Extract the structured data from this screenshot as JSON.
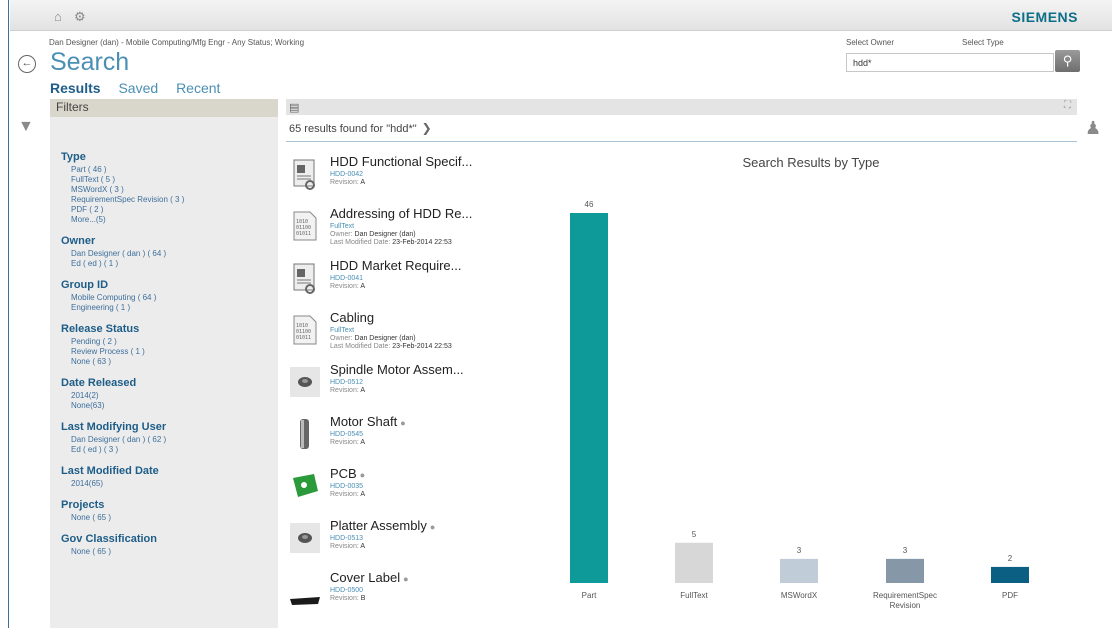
{
  "topbar": {
    "home_icon": "home-icon",
    "settings_icon": "gear-icon",
    "brand": "SIEMENS"
  },
  "context": "Dan Designer (dan) - Mobile Computing/Mfg Engr - Any Status; Working",
  "title": "Search",
  "tabs": [
    {
      "label": "Results",
      "active": true
    },
    {
      "label": "Saved",
      "active": false
    },
    {
      "label": "Recent",
      "active": false
    }
  ],
  "search": {
    "owner_label": "Select Owner",
    "type_label": "Select Type",
    "value": "hdd*"
  },
  "filters": {
    "header": "Filters",
    "groups": [
      {
        "title": "Type",
        "items": [
          "Part ( 46 )",
          "FullText ( 5 )",
          "MSWordX ( 3 )",
          "RequirementSpec Revision ( 3 )",
          "PDF ( 2 )",
          "More...(5)"
        ]
      },
      {
        "title": "Owner",
        "items": [
          "Dan Designer ( dan ) ( 64 )",
          "Ed ( ed ) ( 1 )"
        ]
      },
      {
        "title": "Group ID",
        "items": [
          "Mobile Computing ( 64 )",
          "Engineering ( 1 )"
        ]
      },
      {
        "title": "Release Status",
        "items": [
          "Pending ( 2 )",
          "Review Process ( 1 )",
          "None ( 63 )"
        ]
      },
      {
        "title": "Date Released",
        "items": [
          "2014(2)",
          "None(63)"
        ]
      },
      {
        "title": "Last Modifying User",
        "items": [
          "Dan Designer ( dan ) ( 62 )",
          "Ed ( ed ) ( 3 )"
        ]
      },
      {
        "title": "Last Modified Date",
        "items": [
          "2014(65)"
        ]
      },
      {
        "title": "Projects",
        "items": [
          "None ( 65 )"
        ]
      },
      {
        "title": "Gov Classification",
        "items": [
          "None ( 65 )"
        ]
      }
    ]
  },
  "results": {
    "count_text": "65 results found for \"hdd*\"",
    "items": [
      {
        "title": "HDD Functional Specif...",
        "id": "HDD-0042",
        "rev_label": "Revision:",
        "rev": "A",
        "icon": "document-spec-icon"
      },
      {
        "title": "Addressing of HDD Re...",
        "id": "FullText",
        "owner_label": "Owner:",
        "owner": "Dan Designer (dan)",
        "date_label": "Last Modified Date:",
        "date": "23-Feb-2014 22:53",
        "icon": "binary-file-icon"
      },
      {
        "title": "HDD Market Require...",
        "id": "HDD-0041",
        "rev_label": "Revision:",
        "rev": "A",
        "icon": "document-spec-icon"
      },
      {
        "title": "Cabling",
        "id": "FullText",
        "owner_label": "Owner:",
        "owner": "Dan Designer (dan)",
        "date_label": "Last Modified Date:",
        "date": "23-Feb-2014 22:53",
        "icon": "binary-file-icon"
      },
      {
        "title": "Spindle Motor Assem...",
        "id": "HDD-0512",
        "rev_label": "Revision:",
        "rev": "A",
        "icon": "spindle-motor-thumbnail"
      },
      {
        "title": "Motor Shaft",
        "id": "HDD-0545",
        "rev_label": "Revision:",
        "rev": "A",
        "icon": "motor-shaft-thumbnail"
      },
      {
        "title": "PCB",
        "id": "HDD-0035",
        "rev_label": "Revision:",
        "rev": "A",
        "icon": "pcb-thumbnail"
      },
      {
        "title": "Platter Assembly",
        "id": "HDD-0513",
        "rev_label": "Revision:",
        "rev": "A",
        "icon": "platter-thumbnail"
      },
      {
        "title": "Cover Label",
        "id": "HDD-0500",
        "rev_label": "Revision:",
        "rev": "B",
        "icon": "cover-label-thumbnail"
      }
    ]
  },
  "chart_data": {
    "type": "bar",
    "title": "Search Results by Type",
    "categories": [
      "Part",
      "FullText",
      "MSWordX",
      "RequirementSpec Revision",
      "PDF"
    ],
    "values": [
      46,
      5,
      3,
      3,
      2
    ],
    "colors": [
      "#0e9a98",
      "#d7d7d7",
      "#c0ccd7",
      "#8697a7",
      "#0a5f82"
    ],
    "ylim": [
      0,
      46
    ],
    "grid": false,
    "legend": "none"
  }
}
